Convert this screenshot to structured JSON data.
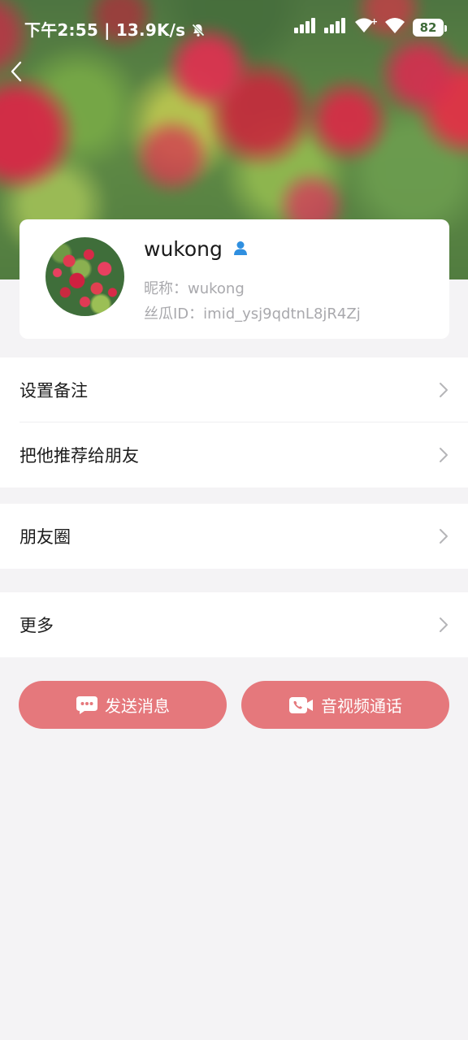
{
  "status_bar": {
    "time": "下午2:55",
    "separator": "|",
    "net_speed": "13.9K/s",
    "battery": "82"
  },
  "profile": {
    "username": "wukong",
    "nickname": "昵称：wukong",
    "sigua_id": "丝瓜ID：imid_ysj9qdtnL8jR4Zj"
  },
  "menu_groups": [
    {
      "items": [
        {
          "label": "设置备注"
        },
        {
          "label": "把他推荐给朋友"
        }
      ]
    },
    {
      "items": [
        {
          "label": "朋友圈"
        }
      ]
    },
    {
      "items": [
        {
          "label": "更多"
        }
      ]
    }
  ],
  "actions": {
    "send_message": "发送消息",
    "av_call": "音视频通话"
  },
  "colors": {
    "accent": "#e5787c",
    "background": "#f4f3f5",
    "badge_blue": "#2f8fe0"
  }
}
